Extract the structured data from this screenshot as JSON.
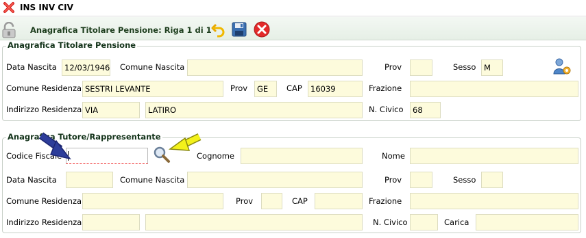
{
  "window": {
    "title": "INS INV CIV"
  },
  "header": {
    "title": "Anagrafica Titolare Pensione: Riga 1 di 1"
  },
  "pensioner": {
    "legend": "Anagrafica Titolare Pensione",
    "labels": {
      "data_nascita": "Data Nascita",
      "comune_nascita": "Comune Nascita",
      "prov": "Prov",
      "sesso": "Sesso",
      "comune_residenza": "Comune Residenza",
      "prov_res": "Prov",
      "cap": "CAP",
      "frazione": "Frazione",
      "indirizzo": "Indirizzo Residenza",
      "civico": "N. Civico"
    },
    "values": {
      "data_nascita": "12/03/1946",
      "comune_nascita": "",
      "prov": "",
      "sesso": "M",
      "comune_residenza": "SESTRI LEVANTE",
      "prov_res": "GE",
      "cap": "16039",
      "frazione": "",
      "indirizzo_tipo": "VIA",
      "indirizzo": "LATIRO",
      "civico": "68"
    }
  },
  "guardian": {
    "legend": "Anagrafica Tutore/Rappresentante",
    "labels": {
      "codice_fiscale": "Codice Fiscale",
      "cognome": "Cognome",
      "nome": "Nome",
      "data_nascita": "Data Nascita",
      "comune_nascita": "Comune Nascita",
      "prov": "Prov",
      "sesso": "Sesso",
      "comune_residenza": "Comune Residenza",
      "prov_res": "Prov",
      "cap": "CAP",
      "frazione": "Frazione",
      "indirizzo": "Indirizzo Residenza",
      "civico": "N. Civico",
      "carica": "Carica"
    },
    "values": {
      "codice_fiscale": "",
      "cognome": "",
      "nome": "",
      "data_nascita": "",
      "comune_nascita": "",
      "prov": "",
      "sesso": "",
      "comune_residenza": "",
      "prov_res": "",
      "cap": "",
      "frazione": "",
      "indirizzo_tipo": "",
      "indirizzo": "",
      "civico": "",
      "carica": ""
    }
  },
  "colors": {
    "field_bg": "#fdfbdc",
    "annotation_arrow_blue": "#2d3d9a",
    "annotation_arrow_yellow": "#f3f11a",
    "close_red": "#e32a2a"
  },
  "icons": {
    "window": "close-x-icon",
    "header": "lock-icon",
    "undo": "undo-arrow-icon",
    "save": "floppy-disk-icon",
    "cancel": "cancel-circle-icon",
    "user": "user-settings-icon",
    "lookup": "magnifier-icon"
  }
}
